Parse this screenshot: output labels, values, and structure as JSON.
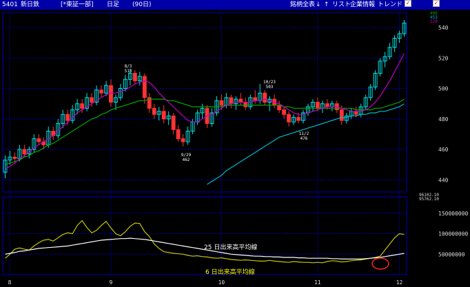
{
  "toolbar": {
    "code": "5401",
    "name": "新日鉄",
    "market": "[*東証一部]",
    "period": "日足",
    "days": "(90日)",
    "btn_all": "銘柄全表",
    "btn_down": "↓",
    "btn_up": "↑",
    "btn_list": "リスト",
    "btn_info": "企業情報",
    "btn_trend": "トレンド",
    "chk1": "",
    "chk2": "",
    "checked_mark": "✓"
  },
  "colors": {
    "up_candle": "#00e5e5",
    "down_candle": "#ff3333",
    "ma_short": "#c000c0",
    "ma_mid": "#00aa00",
    "ma_long": "#00bbcc",
    "volume_line": "#c8c800",
    "volume_avg25": "#ffffff",
    "grid": "#0000c0"
  },
  "chart_data": [
    {
      "type": "candlestick",
      "y_ticks": [
        440,
        460,
        480,
        500,
        520,
        540
      ],
      "ylim": [
        432,
        550
      ],
      "x_ticks": [
        "8",
        "9",
        "10",
        "11",
        "12"
      ],
      "top_right_labels": [
        "496",
        "453",
        "528"
      ],
      "annotations": [
        {
          "label": "8/3",
          "value": "513"
        },
        {
          "label": "9/29",
          "value": "462"
        },
        {
          "label": "10/23",
          "value": "503"
        },
        {
          "label": "11/2",
          "value": "476"
        }
      ],
      "candles": [
        {
          "o": 445,
          "h": 456,
          "l": 441,
          "c": 453
        },
        {
          "o": 453,
          "h": 459,
          "l": 450,
          "c": 455
        },
        {
          "o": 455,
          "h": 458,
          "l": 452,
          "c": 454
        },
        {
          "o": 454,
          "h": 463,
          "l": 452,
          "c": 460
        },
        {
          "o": 460,
          "h": 463,
          "l": 455,
          "c": 457
        },
        {
          "o": 457,
          "h": 462,
          "l": 454,
          "c": 460
        },
        {
          "o": 460,
          "h": 470,
          "l": 458,
          "c": 467
        },
        {
          "o": 467,
          "h": 470,
          "l": 463,
          "c": 465
        },
        {
          "o": 465,
          "h": 468,
          "l": 460,
          "c": 463
        },
        {
          "o": 463,
          "h": 475,
          "l": 461,
          "c": 472
        },
        {
          "o": 472,
          "h": 475,
          "l": 466,
          "c": 469
        },
        {
          "o": 469,
          "h": 480,
          "l": 467,
          "c": 477
        },
        {
          "o": 477,
          "h": 486,
          "l": 474,
          "c": 483
        },
        {
          "o": 483,
          "h": 486,
          "l": 476,
          "c": 479
        },
        {
          "o": 479,
          "h": 489,
          "l": 477,
          "c": 486
        },
        {
          "o": 486,
          "h": 493,
          "l": 483,
          "c": 490
        },
        {
          "o": 490,
          "h": 493,
          "l": 484,
          "c": 487
        },
        {
          "o": 487,
          "h": 497,
          "l": 485,
          "c": 494
        },
        {
          "o": 494,
          "h": 497,
          "l": 488,
          "c": 491
        },
        {
          "o": 491,
          "h": 502,
          "l": 489,
          "c": 499
        },
        {
          "o": 499,
          "h": 502,
          "l": 494,
          "c": 497
        },
        {
          "o": 497,
          "h": 505,
          "l": 495,
          "c": 502
        },
        {
          "o": 502,
          "h": 506,
          "l": 488,
          "c": 491
        },
        {
          "o": 491,
          "h": 496,
          "l": 486,
          "c": 494
        },
        {
          "o": 494,
          "h": 503,
          "l": 492,
          "c": 500
        },
        {
          "o": 500,
          "h": 509,
          "l": 498,
          "c": 506
        },
        {
          "o": 506,
          "h": 513,
          "l": 502,
          "c": 510
        },
        {
          "o": 510,
          "h": 512,
          "l": 503,
          "c": 505
        },
        {
          "o": 505,
          "h": 511,
          "l": 502,
          "c": 508
        },
        {
          "o": 508,
          "h": 510,
          "l": 490,
          "c": 494
        },
        {
          "o": 494,
          "h": 497,
          "l": 484,
          "c": 487
        },
        {
          "o": 487,
          "h": 490,
          "l": 480,
          "c": 483
        },
        {
          "o": 483,
          "h": 488,
          "l": 479,
          "c": 485
        },
        {
          "o": 485,
          "h": 489,
          "l": 477,
          "c": 480
        },
        {
          "o": 480,
          "h": 485,
          "l": 476,
          "c": 482
        },
        {
          "o": 482,
          "h": 484,
          "l": 470,
          "c": 473
        },
        {
          "o": 473,
          "h": 476,
          "l": 465,
          "c": 467
        },
        {
          "o": 467,
          "h": 470,
          "l": 462,
          "c": 465
        },
        {
          "o": 465,
          "h": 475,
          "l": 463,
          "c": 472
        },
        {
          "o": 472,
          "h": 480,
          "l": 470,
          "c": 478
        },
        {
          "o": 478,
          "h": 486,
          "l": 476,
          "c": 484
        },
        {
          "o": 484,
          "h": 490,
          "l": 480,
          "c": 487
        },
        {
          "o": 487,
          "h": 489,
          "l": 474,
          "c": 477
        },
        {
          "o": 477,
          "h": 487,
          "l": 475,
          "c": 484
        },
        {
          "o": 484,
          "h": 495,
          "l": 482,
          "c": 492
        },
        {
          "o": 492,
          "h": 496,
          "l": 486,
          "c": 489
        },
        {
          "o": 489,
          "h": 497,
          "l": 487,
          "c": 494
        },
        {
          "o": 494,
          "h": 496,
          "l": 487,
          "c": 490
        },
        {
          "o": 490,
          "h": 495,
          "l": 486,
          "c": 493
        },
        {
          "o": 493,
          "h": 497,
          "l": 489,
          "c": 491
        },
        {
          "o": 491,
          "h": 494,
          "l": 486,
          "c": 488
        },
        {
          "o": 488,
          "h": 496,
          "l": 486,
          "c": 494
        },
        {
          "o": 494,
          "h": 499,
          "l": 490,
          "c": 492
        },
        {
          "o": 492,
          "h": 503,
          "l": 490,
          "c": 497
        },
        {
          "o": 497,
          "h": 499,
          "l": 489,
          "c": 491
        },
        {
          "o": 491,
          "h": 495,
          "l": 485,
          "c": 493
        },
        {
          "o": 493,
          "h": 496,
          "l": 487,
          "c": 489
        },
        {
          "o": 489,
          "h": 492,
          "l": 484,
          "c": 486
        },
        {
          "o": 486,
          "h": 488,
          "l": 480,
          "c": 483
        },
        {
          "o": 483,
          "h": 485,
          "l": 475,
          "c": 478
        },
        {
          "o": 478,
          "h": 483,
          "l": 476,
          "c": 481
        },
        {
          "o": 481,
          "h": 484,
          "l": 477,
          "c": 479
        },
        {
          "o": 479,
          "h": 486,
          "l": 477,
          "c": 484
        },
        {
          "o": 484,
          "h": 490,
          "l": 482,
          "c": 488
        },
        {
          "o": 488,
          "h": 493,
          "l": 485,
          "c": 491
        },
        {
          "o": 491,
          "h": 494,
          "l": 485,
          "c": 487
        },
        {
          "o": 487,
          "h": 492,
          "l": 484,
          "c": 490
        },
        {
          "o": 490,
          "h": 493,
          "l": 486,
          "c": 488
        },
        {
          "o": 488,
          "h": 492,
          "l": 485,
          "c": 490
        },
        {
          "o": 490,
          "h": 492,
          "l": 484,
          "c": 486
        },
        {
          "o": 486,
          "h": 489,
          "l": 476,
          "c": 479
        },
        {
          "o": 479,
          "h": 484,
          "l": 477,
          "c": 482
        },
        {
          "o": 482,
          "h": 487,
          "l": 480,
          "c": 485
        },
        {
          "o": 485,
          "h": 488,
          "l": 481,
          "c": 483
        },
        {
          "o": 483,
          "h": 490,
          "l": 481,
          "c": 488
        },
        {
          "o": 488,
          "h": 496,
          "l": 486,
          "c": 494
        },
        {
          "o": 494,
          "h": 503,
          "l": 492,
          "c": 501
        },
        {
          "o": 501,
          "h": 512,
          "l": 499,
          "c": 510
        },
        {
          "o": 510,
          "h": 520,
          "l": 508,
          "c": 518
        },
        {
          "o": 518,
          "h": 524,
          "l": 514,
          "c": 521
        },
        {
          "o": 521,
          "h": 530,
          "l": 519,
          "c": 527
        },
        {
          "o": 527,
          "h": 535,
          "l": 524,
          "c": 533
        },
        {
          "o": 533,
          "h": 538,
          "l": 530,
          "c": 536
        },
        {
          "o": 536,
          "h": 545,
          "l": 534,
          "c": 543
        }
      ],
      "ma_short": [
        447,
        449,
        451,
        454,
        456,
        458,
        461,
        463,
        465,
        467,
        469,
        472,
        475,
        478,
        481,
        484,
        486,
        488,
        490,
        492,
        494,
        496,
        497,
        497,
        498,
        499,
        501,
        503,
        504,
        505,
        504,
        501,
        497,
        494,
        491,
        488,
        485,
        482,
        479,
        478,
        478,
        480,
        482,
        483,
        485,
        487,
        489,
        490,
        491,
        491,
        491,
        491,
        492,
        492,
        493,
        492,
        491,
        490,
        488,
        486,
        484,
        483,
        483,
        484,
        485,
        486,
        487,
        488,
        488,
        488,
        487,
        486,
        485,
        485,
        485,
        486,
        488,
        491,
        495,
        500,
        505,
        511,
        517,
        523
      ],
      "ma_mid": [
        450,
        451,
        452,
        453,
        455,
        456,
        458,
        459,
        461,
        463,
        464,
        466,
        468,
        470,
        472,
        474,
        476,
        478,
        480,
        481,
        483,
        484,
        486,
        487,
        488,
        489,
        490,
        491,
        492,
        492,
        493,
        493,
        493,
        493,
        492,
        492,
        491,
        490,
        489,
        488,
        488,
        488,
        488,
        488,
        488,
        488,
        489,
        489,
        489,
        489,
        489,
        489,
        489,
        489,
        489,
        489,
        489,
        489,
        488,
        488,
        487,
        487,
        487,
        487,
        487,
        487,
        487,
        487,
        487,
        487,
        487,
        487,
        487,
        486,
        486,
        486,
        486,
        487,
        487,
        488,
        489,
        490,
        491,
        493
      ],
      "ma_long": [
        null,
        null,
        null,
        null,
        null,
        null,
        null,
        null,
        null,
        null,
        null,
        null,
        null,
        null,
        null,
        null,
        null,
        null,
        null,
        null,
        null,
        null,
        null,
        null,
        null,
        null,
        null,
        null,
        null,
        null,
        null,
        null,
        null,
        null,
        null,
        null,
        null,
        null,
        null,
        null,
        null,
        null,
        437,
        439,
        441,
        443,
        446,
        448,
        450,
        452,
        454,
        456,
        458,
        460,
        462,
        464,
        466,
        468,
        469,
        470,
        471,
        472,
        473,
        474,
        475,
        476,
        477,
        478,
        479,
        480,
        481,
        481,
        482,
        482,
        483,
        483,
        484,
        484,
        485,
        485,
        486,
        487,
        488,
        490
      ]
    },
    {
      "type": "line",
      "y_ticks": [
        "50000000",
        "100000000",
        "150000000"
      ],
      "ylim": [
        0,
        190000000
      ],
      "top_right_labels": [
        "96102.10",
        "95762.10"
      ],
      "series": [
        {
          "name": "6 日出来高平均線",
          "values": [
            40,
            50,
            62,
            65,
            62,
            60,
            70,
            78,
            84,
            86,
            82,
            90,
            98,
            102,
            100,
            120,
            132,
            115,
            102,
            108,
            120,
            130,
            114,
            100,
            95,
            105,
            118,
            126,
            125,
            105,
            93,
            75,
            64,
            56,
            54,
            52,
            51,
            50,
            47,
            45,
            46,
            44,
            43,
            41,
            40,
            41,
            39,
            37,
            36,
            35,
            36,
            35,
            34,
            33,
            33,
            35,
            33,
            32,
            31,
            30,
            32,
            31,
            30,
            30,
            29,
            30,
            29,
            32,
            34,
            33,
            31,
            32,
            34,
            35,
            36,
            38,
            40,
            42,
            45,
            60,
            75,
            90,
            100,
            98
          ]
        },
        {
          "name": "25 日出来高平均線",
          "values": [
            50,
            52,
            54,
            57,
            58,
            60,
            62,
            64,
            65,
            66,
            67,
            68,
            69,
            70,
            72,
            74,
            76,
            78,
            80,
            82,
            84,
            85,
            86,
            87,
            88,
            88,
            89,
            88,
            87,
            86,
            84,
            82,
            80,
            78,
            76,
            74,
            72,
            70,
            68,
            66,
            64,
            62,
            60,
            58,
            56,
            54,
            52,
            50,
            49,
            48,
            47,
            46,
            45,
            45,
            44,
            44,
            43,
            43,
            42,
            42,
            42,
            41,
            41,
            40,
            40,
            40,
            40,
            40,
            39,
            39,
            38,
            38,
            38,
            38,
            38,
            39,
            40,
            41,
            42,
            44,
            46,
            48,
            50,
            52
          ]
        }
      ]
    }
  ]
}
